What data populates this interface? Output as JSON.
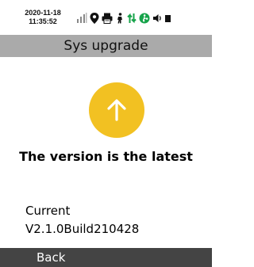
{
  "status_bar": {
    "date": "2020-11-18",
    "time": "11:35:52",
    "icons": [
      "signal-bars-icon",
      "location-pin-icon",
      "printer-icon",
      "person-icon",
      "data-transfer-icon",
      "fan-icon",
      "speaker-icon",
      "battery-icon"
    ],
    "accent_color": "#16a34a"
  },
  "header": {
    "title": "Sys upgrade"
  },
  "main": {
    "icon": "arrow-up-icon",
    "icon_color": "#f2c122",
    "message": "The version is the latest",
    "current_label": "Current",
    "current_version": "V2.1.0Build210428"
  },
  "footer": {
    "back_label": "Back"
  }
}
